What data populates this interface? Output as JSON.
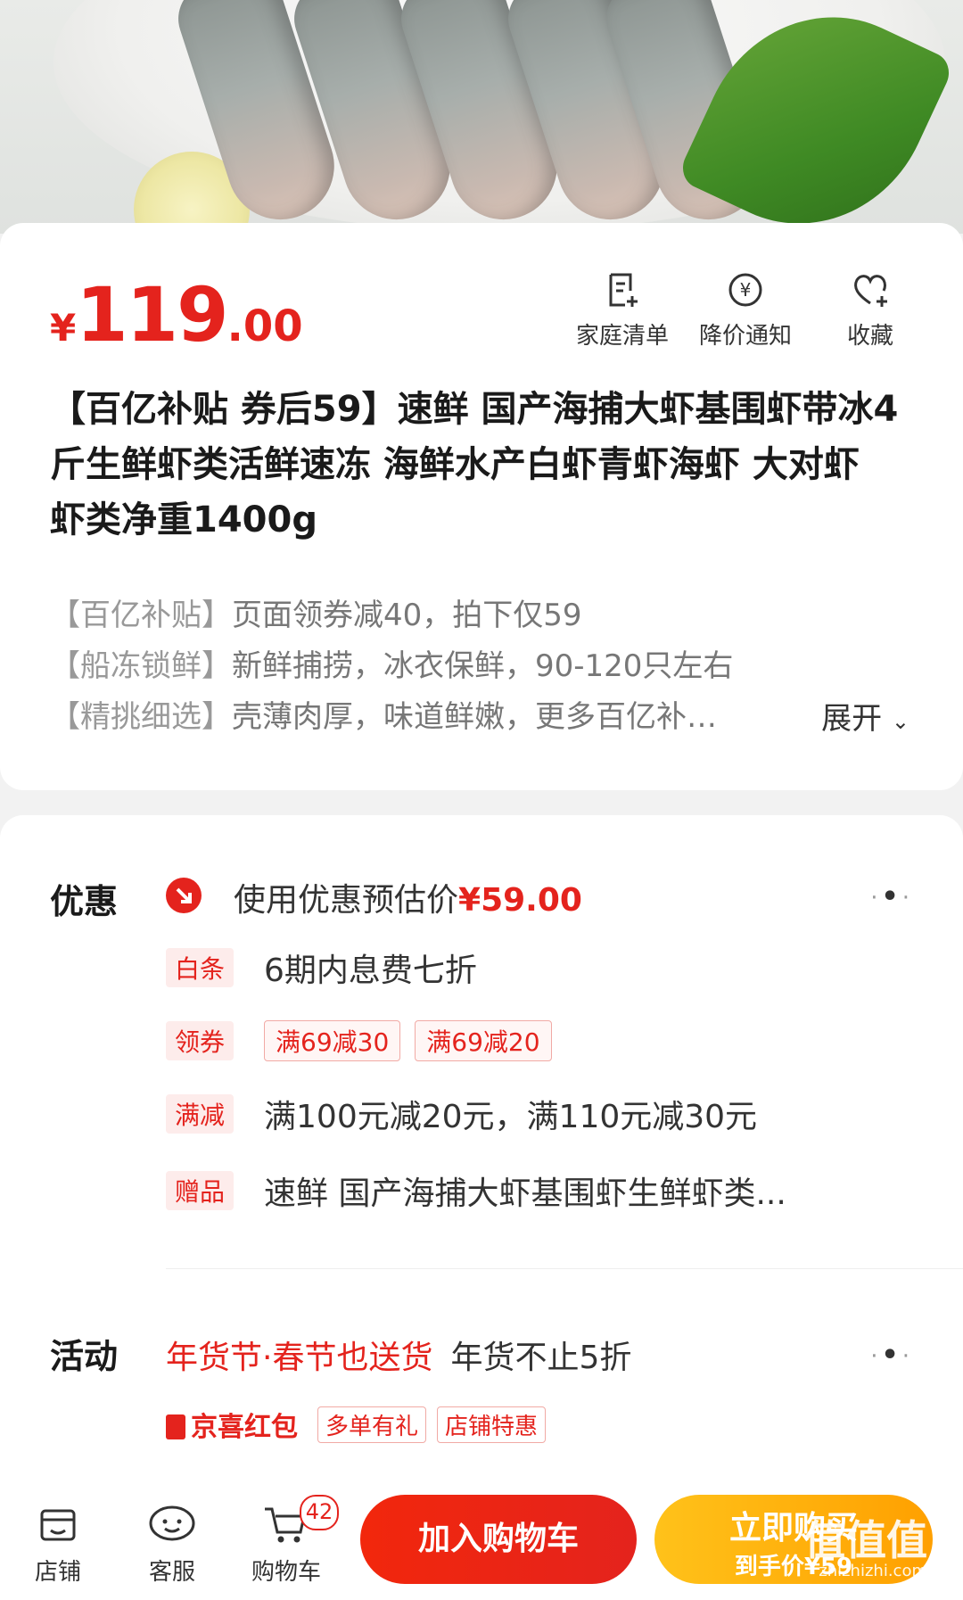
{
  "product": {
    "price_symbol": "¥",
    "price_integer": "119",
    "price_decimal": ".00",
    "title": "【百亿补贴 券后59】速鲜 国产海捕大虾基围虾带冰4斤生鲜虾类活鲜速冻 海鲜水产白虾青虾海虾 大对虾 虾类净重1400g",
    "quick_actions": [
      {
        "label": "家庭清单",
        "icon": "list-add-icon"
      },
      {
        "label": "降价通知",
        "icon": "price-alert-icon"
      },
      {
        "label": "收藏",
        "icon": "heart-add-icon"
      }
    ],
    "selling_points": [
      {
        "tag": "【百亿补贴】",
        "text": "页面领券减40，拍下仅59"
      },
      {
        "tag": "【船冻锁鲜】",
        "text": "新鲜捕捞，冰衣保鲜，90-120只左右"
      },
      {
        "tag": "【精挑细选】",
        "text": "壳薄肉厚，味道鲜嫩，更多百亿补…"
      }
    ],
    "expand_label": "展开"
  },
  "promotions": {
    "label": "优惠",
    "estimate_text": "使用优惠预估价",
    "estimate_price": "¥59.00",
    "rows": [
      {
        "badge": "白条",
        "text": "6期内息费七折"
      },
      {
        "badge": "领券",
        "coupons": [
          "满69减30",
          "满69减20"
        ]
      },
      {
        "badge": "满减",
        "text": "满100元减20元，满110元减30元"
      },
      {
        "badge": "赠品",
        "text": "速鲜 国产海捕大虾基围虾生鲜虾类..."
      }
    ]
  },
  "activity": {
    "label": "活动",
    "brand": "年货节·春节也送货",
    "text": "年货不止5折",
    "jingxi": "京喜红包",
    "tags": [
      "多单有礼",
      "店铺特惠"
    ]
  },
  "bottom_bar": {
    "store": "店铺",
    "service": "客服",
    "cart": "购物车",
    "cart_count": "42",
    "add_to_cart": "加入购物车",
    "buy_now": "立即购买",
    "buy_now_sub": "到手价¥59",
    "watermark": "值值值",
    "watermark_url": "zhizhizhi.com"
  },
  "colors": {
    "accent": "#e4231d",
    "buy": "#ffa000"
  }
}
